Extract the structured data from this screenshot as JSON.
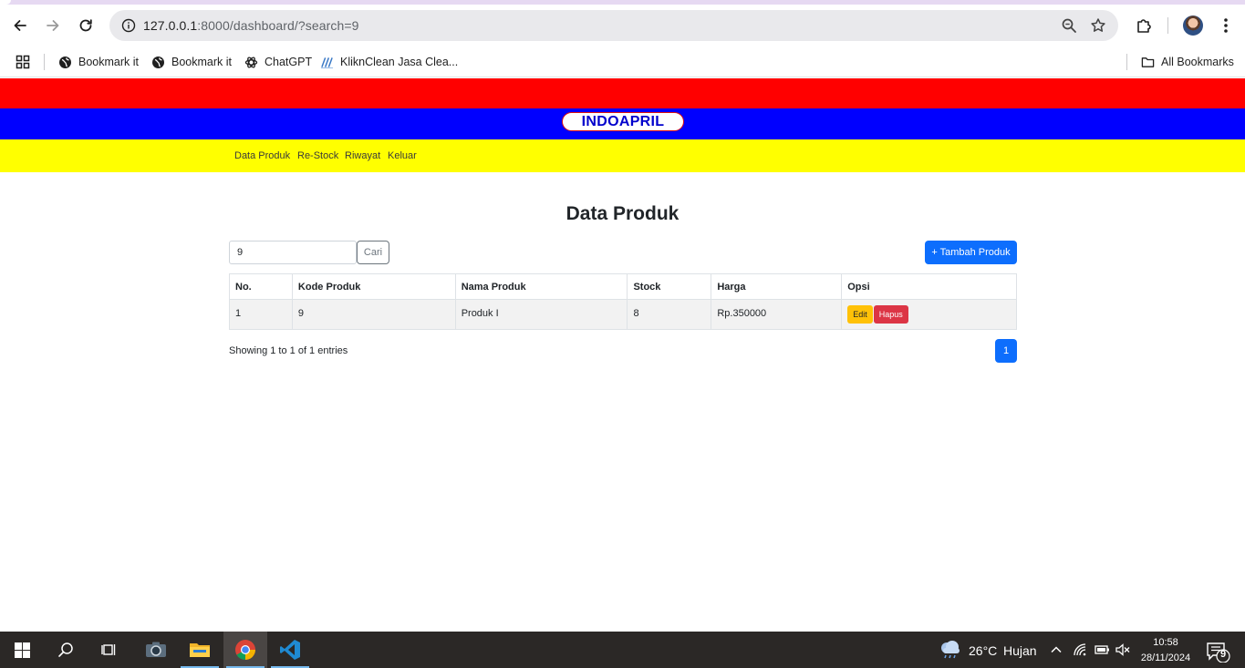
{
  "browser": {
    "url_host": "127.0.0.1",
    "url_rest": ":8000/dashboard/?search=9",
    "bookmarks": [
      {
        "label": "Bookmark it",
        "icon": "globe-icon"
      },
      {
        "label": "Bookmark it",
        "icon": "globe-icon"
      },
      {
        "label": "ChatGPT",
        "icon": "openai-icon"
      },
      {
        "label": "KliknClean Jasa Clea...",
        "icon": "kliknclean-icon"
      }
    ],
    "all_bookmarks": "All Bookmarks"
  },
  "site": {
    "brand": "INDOAPRIL",
    "colors": {
      "red": "#ff0000",
      "blue": "#0000ff",
      "yellow": "#ffff00"
    },
    "nav": [
      "Data Produk",
      "Re-Stock",
      "Riwayat",
      "Keluar"
    ]
  },
  "page": {
    "title": "Data Produk",
    "search_value": "9",
    "search_button": "Cari",
    "add_button": "+ Tambah Produk",
    "table": {
      "headers": [
        "No.",
        "Kode Produk",
        "Nama Produk",
        "Stock",
        "Harga",
        "Opsi"
      ],
      "rows": [
        {
          "no": "1",
          "kode": "9",
          "nama": "Produk I",
          "stock": "8",
          "harga": "Rp.350000",
          "edit": "Edit",
          "hapus": "Hapus"
        }
      ]
    },
    "showing": "Showing 1 to 1 of 1 entries",
    "current_page": "1"
  },
  "taskbar": {
    "weather_temp": "26°C",
    "weather_text": "Hujan",
    "time": "10:58",
    "date": "28/11/2024",
    "notifications": "9"
  }
}
